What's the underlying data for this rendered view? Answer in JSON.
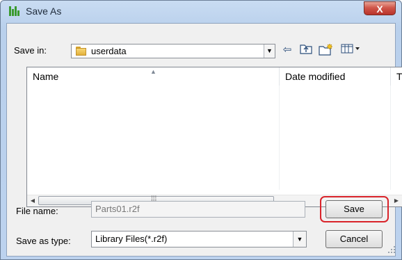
{
  "window": {
    "title": "Save As",
    "close_label": "X"
  },
  "toolbar": {
    "save_in_label": "Save in:",
    "save_in_value": "userdata",
    "icons": [
      "back-icon",
      "up-folder-icon",
      "new-folder-icon",
      "view-menu-icon"
    ]
  },
  "file_list": {
    "columns": [
      "Name",
      "Date modified",
      "Ty"
    ],
    "items": []
  },
  "form": {
    "file_name_label": "File name:",
    "file_name_value": "Parts01.r2f",
    "save_type_label": "Save as type:",
    "save_type_value": "Library Files(*.r2f)"
  },
  "buttons": {
    "save": "Save",
    "cancel": "Cancel"
  },
  "colors": {
    "highlight": "#d9232a",
    "title_bar": "#c9dcf2",
    "close_button": "#c9473c"
  }
}
